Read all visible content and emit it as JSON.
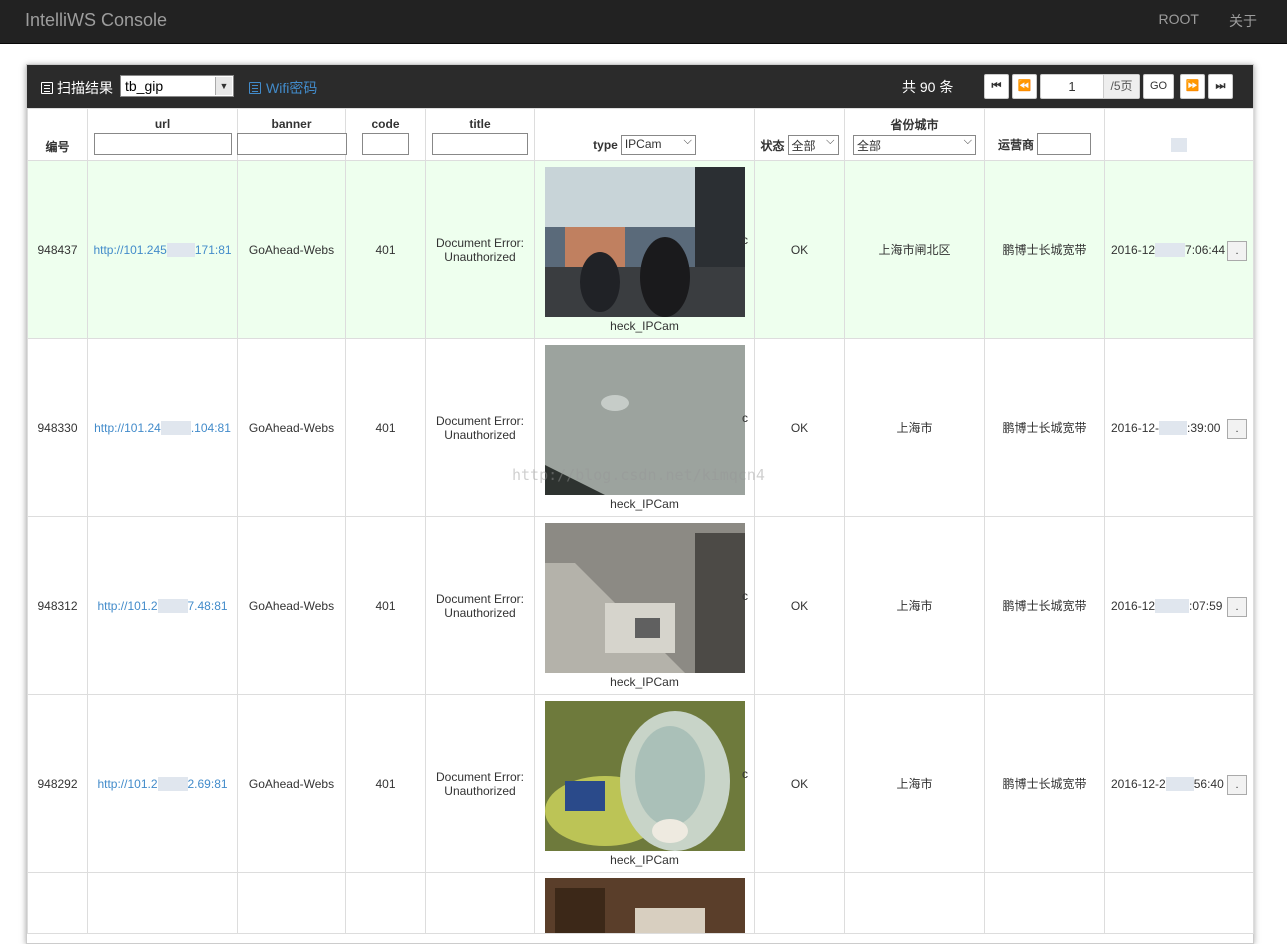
{
  "app": {
    "brand": "IntelliWS Console",
    "nav": [
      "ROOT",
      "关于"
    ]
  },
  "toolbar": {
    "scan_label": "扫描结果",
    "table_select": "tb_gip",
    "wifi_label": "Wifi密码",
    "total": "共 90 条",
    "page_current": "1",
    "page_total": "/5页",
    "go_label": "GO",
    "icons": {
      "first": "⏮",
      "prev": "⏪",
      "next": "⏩",
      "last": "⏭"
    }
  },
  "columns": {
    "id": "编号",
    "url": "url",
    "banner": "banner",
    "code": "code",
    "title": "title",
    "type": "type",
    "type_filter": "IPCam",
    "status": "状态",
    "status_filter": "全部",
    "region": "省份城市",
    "region_filter": "全部",
    "isp": "运营商"
  },
  "rows": [
    {
      "id": "948437",
      "url_a": "http://101.245",
      "url_b": "171:81",
      "banner": "GoAhead-Webs",
      "code": "401",
      "title": "Document Error: Unauthorized",
      "type_caption": "heck_IPCam",
      "type_frag": "c",
      "status": "OK",
      "region": "上海市闸北区",
      "isp": "鹏博士长城宽带",
      "time_a": "2016-12",
      "time_b": "7:06:44",
      "btn": "."
    },
    {
      "id": "948330",
      "url_a": "http://101.24",
      "url_b": ".104:81",
      "banner": "GoAhead-Webs",
      "code": "401",
      "title": "Document Error: Unauthorized",
      "type_caption": "heck_IPCam",
      "type_frag": "c",
      "status": "OK",
      "region": "上海市",
      "isp": "鹏博士长城宽带",
      "time_a": "2016-12-",
      "time_b": ":39:00",
      "btn": "."
    },
    {
      "id": "948312",
      "url_a": "http://101.2",
      "url_b": "7.48:81",
      "banner": "GoAhead-Webs",
      "code": "401",
      "title": "Document Error: Unauthorized",
      "type_caption": "heck_IPCam",
      "type_frag": "c",
      "status": "OK",
      "region": "上海市",
      "isp": "鹏博士长城宽带",
      "time_a": "2016-12",
      "time_b": ":07:59",
      "btn": "."
    },
    {
      "id": "948292",
      "url_a": "http://101.2",
      "url_b": "2.69:81",
      "banner": "GoAhead-Webs",
      "code": "401",
      "title": "Document Error: Unauthorized",
      "type_caption": "heck_IPCam",
      "type_frag": "c",
      "status": "OK",
      "region": "上海市",
      "isp": "鹏博士长城宽带",
      "time_a": "2016-12-2",
      "time_b": "56:40",
      "btn": "."
    }
  ],
  "watermark": "http://blog.csdn.net/kimqcn4"
}
